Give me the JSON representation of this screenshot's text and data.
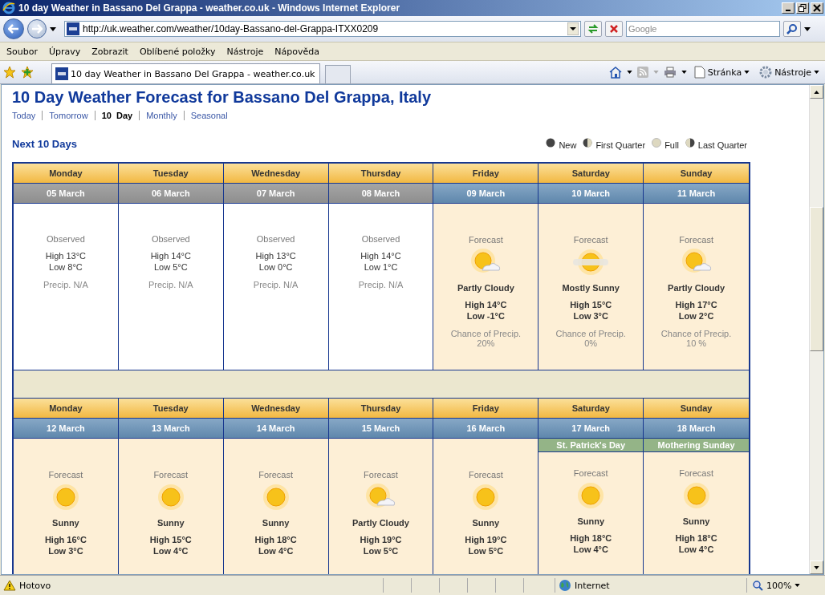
{
  "window": {
    "title": "10 day Weather in Bassano Del Grappa - weather.co.uk - Windows Internet Explorer"
  },
  "address_bar": {
    "url": "http://uk.weather.com/weather/10day-Bassano-del-Grappa-ITXX0209",
    "search_placeholder": "Google"
  },
  "menu": [
    "Soubor",
    "Úpravy",
    "Zobrazit",
    "Oblíbené položky",
    "Nástroje",
    "Nápověda"
  ],
  "tabs": [
    {
      "label": "10 day Weather in Bassano Del Grappa - weather.co.uk",
      "selected": true
    }
  ],
  "command_bar": [
    "Stránka",
    "Nástroje"
  ],
  "page": {
    "heading": "10 Day Weather Forecast for Bassano Del Grappa, Italy",
    "nav": [
      {
        "label": "Today",
        "selected": false
      },
      {
        "label": "Tomorrow",
        "selected": false
      },
      {
        "label": "10  Day",
        "selected": true
      },
      {
        "label": "Monthly",
        "selected": false
      },
      {
        "label": "Seasonal",
        "selected": false
      }
    ],
    "section_title": "Next 10 Days",
    "moon_legend": [
      {
        "label": "New",
        "kind": "new"
      },
      {
        "label": "First Quarter",
        "kind": "first"
      },
      {
        "label": "Full",
        "kind": "full"
      },
      {
        "label": "Last Quarter",
        "kind": "last"
      }
    ],
    "weeks": [
      [
        {
          "day": "Monday",
          "date": "05 March",
          "kind": "observed",
          "label": "Observed",
          "high": "High 13°C",
          "low": "Low 8°C",
          "precip": "Precip. N/A"
        },
        {
          "day": "Tuesday",
          "date": "06 March",
          "kind": "observed",
          "label": "Observed",
          "high": "High 14°C",
          "low": "Low 5°C",
          "precip": "Precip. N/A"
        },
        {
          "day": "Wednesday",
          "date": "07 March",
          "kind": "observed",
          "label": "Observed",
          "high": "High 13°C",
          "low": "Low 0°C",
          "precip": "Precip. N/A"
        },
        {
          "day": "Thursday",
          "date": "08 March",
          "kind": "observed",
          "label": "Observed",
          "high": "High 14°C",
          "low": "Low 1°C",
          "precip": "Precip. N/A"
        },
        {
          "day": "Friday",
          "date": "09 March",
          "kind": "forecast",
          "label": "Forecast",
          "icon": {
            "kind": "partly-cloudy"
          },
          "condition": "Partly Cloudy",
          "high": "High 14°C",
          "low": "Low -1°C",
          "precip_label": "Chance of Precip.",
          "precip": "20%"
        },
        {
          "day": "Saturday",
          "date": "10 March",
          "kind": "forecast",
          "label": "Forecast",
          "icon": {
            "kind": "mostly-sunny"
          },
          "condition": "Mostly Sunny",
          "high": "High 15°C",
          "low": "Low 3°C",
          "precip_label": "Chance of Precip.",
          "precip": "0%"
        },
        {
          "day": "Sunday",
          "date": "11 March",
          "kind": "forecast",
          "label": "Forecast",
          "icon": {
            "kind": "partly-cloudy"
          },
          "condition": "Partly Cloudy",
          "high": "High 17°C",
          "low": "Low 2°C",
          "precip_label": "Chance of Precip.",
          "precip": "10 %"
        }
      ],
      [
        {
          "day": "Monday",
          "date": "12 March",
          "kind": "forecast",
          "label": "Forecast",
          "icon": {
            "kind": "sunny"
          },
          "condition": "Sunny",
          "high": "High 16°C",
          "low": "Low 3°C"
        },
        {
          "day": "Tuesday",
          "date": "13 March",
          "kind": "forecast",
          "label": "Forecast",
          "icon": {
            "kind": "sunny"
          },
          "condition": "Sunny",
          "high": "High 15°C",
          "low": "Low 4°C"
        },
        {
          "day": "Wednesday",
          "date": "14 March",
          "kind": "forecast",
          "label": "Forecast",
          "icon": {
            "kind": "sunny"
          },
          "condition": "Sunny",
          "high": "High 18°C",
          "low": "Low 4°C"
        },
        {
          "day": "Thursday",
          "date": "15 March",
          "kind": "forecast",
          "label": "Forecast",
          "icon": {
            "kind": "partly-cloudy"
          },
          "condition": "Partly Cloudy",
          "high": "High 19°C",
          "low": "Low 5°C"
        },
        {
          "day": "Friday",
          "date": "16 March",
          "kind": "forecast",
          "label": "Forecast",
          "icon": {
            "kind": "sunny"
          },
          "condition": "Sunny",
          "high": "High 19°C",
          "low": "Low 5°C"
        },
        {
          "day": "Saturday",
          "date": "17 March",
          "kind": "forecast",
          "holiday": "St. Patrick's Day",
          "label": "Forecast",
          "icon": {
            "kind": "sunny"
          },
          "condition": "Sunny",
          "high": "High 18°C",
          "low": "Low 4°C"
        },
        {
          "day": "Sunday",
          "date": "18 March",
          "kind": "forecast",
          "holiday": "Mothering Sunday",
          "label": "Forecast",
          "icon": {
            "kind": "sunny"
          },
          "condition": "Sunny",
          "high": "High 18°C",
          "low": "Low 4°C"
        }
      ]
    ]
  },
  "status_bar": {
    "status": "Hotovo",
    "zone": "Internet",
    "zoom": "100%"
  }
}
